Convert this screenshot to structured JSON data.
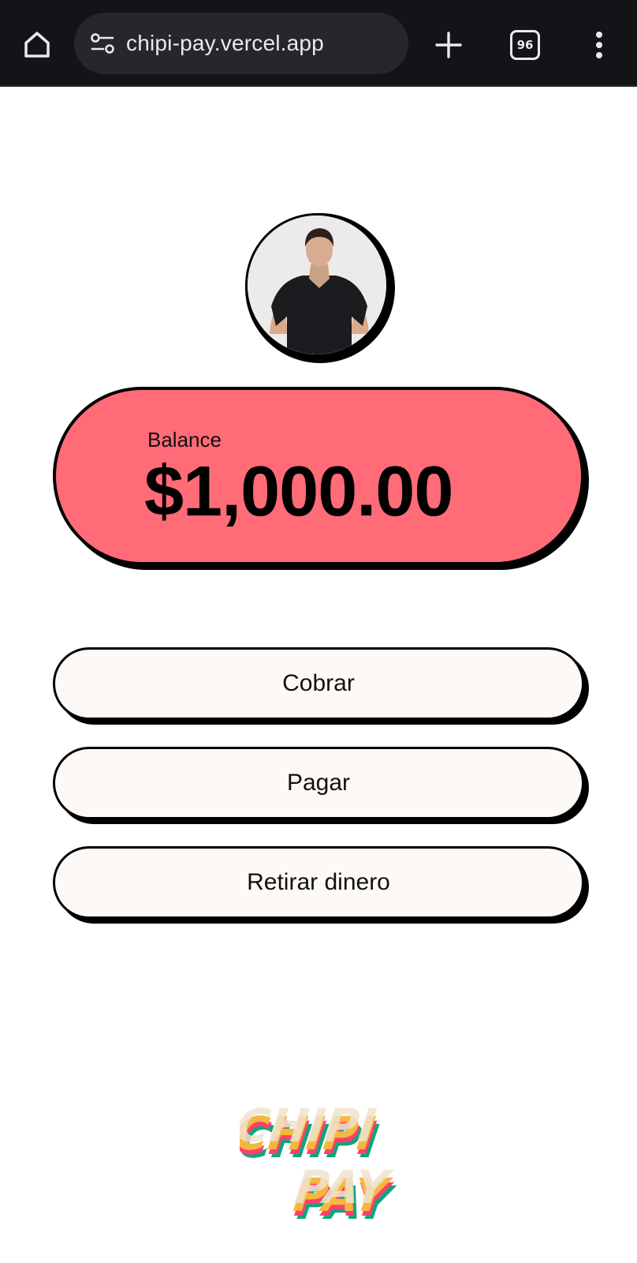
{
  "browser": {
    "url": "chipi-pay.vercel.app",
    "tab_count": "96",
    "icons": {
      "home": "home-icon",
      "site_settings": "site-settings-icon",
      "new_tab": "plus-icon",
      "tabs": "tab-switcher-icon",
      "menu": "more-vert-icon"
    }
  },
  "app": {
    "balance": {
      "label": "Balance",
      "amount": "$1,000.00"
    },
    "actions": [
      {
        "label": "Cobrar"
      },
      {
        "label": "Pagar"
      },
      {
        "label": "Retirar dinero"
      }
    ],
    "logo_text": "CHIPI PAY",
    "colors": {
      "balance_card": "#ff6b77",
      "button_bg": "#fdf9f6",
      "toolbar_bg": "#131417"
    }
  }
}
